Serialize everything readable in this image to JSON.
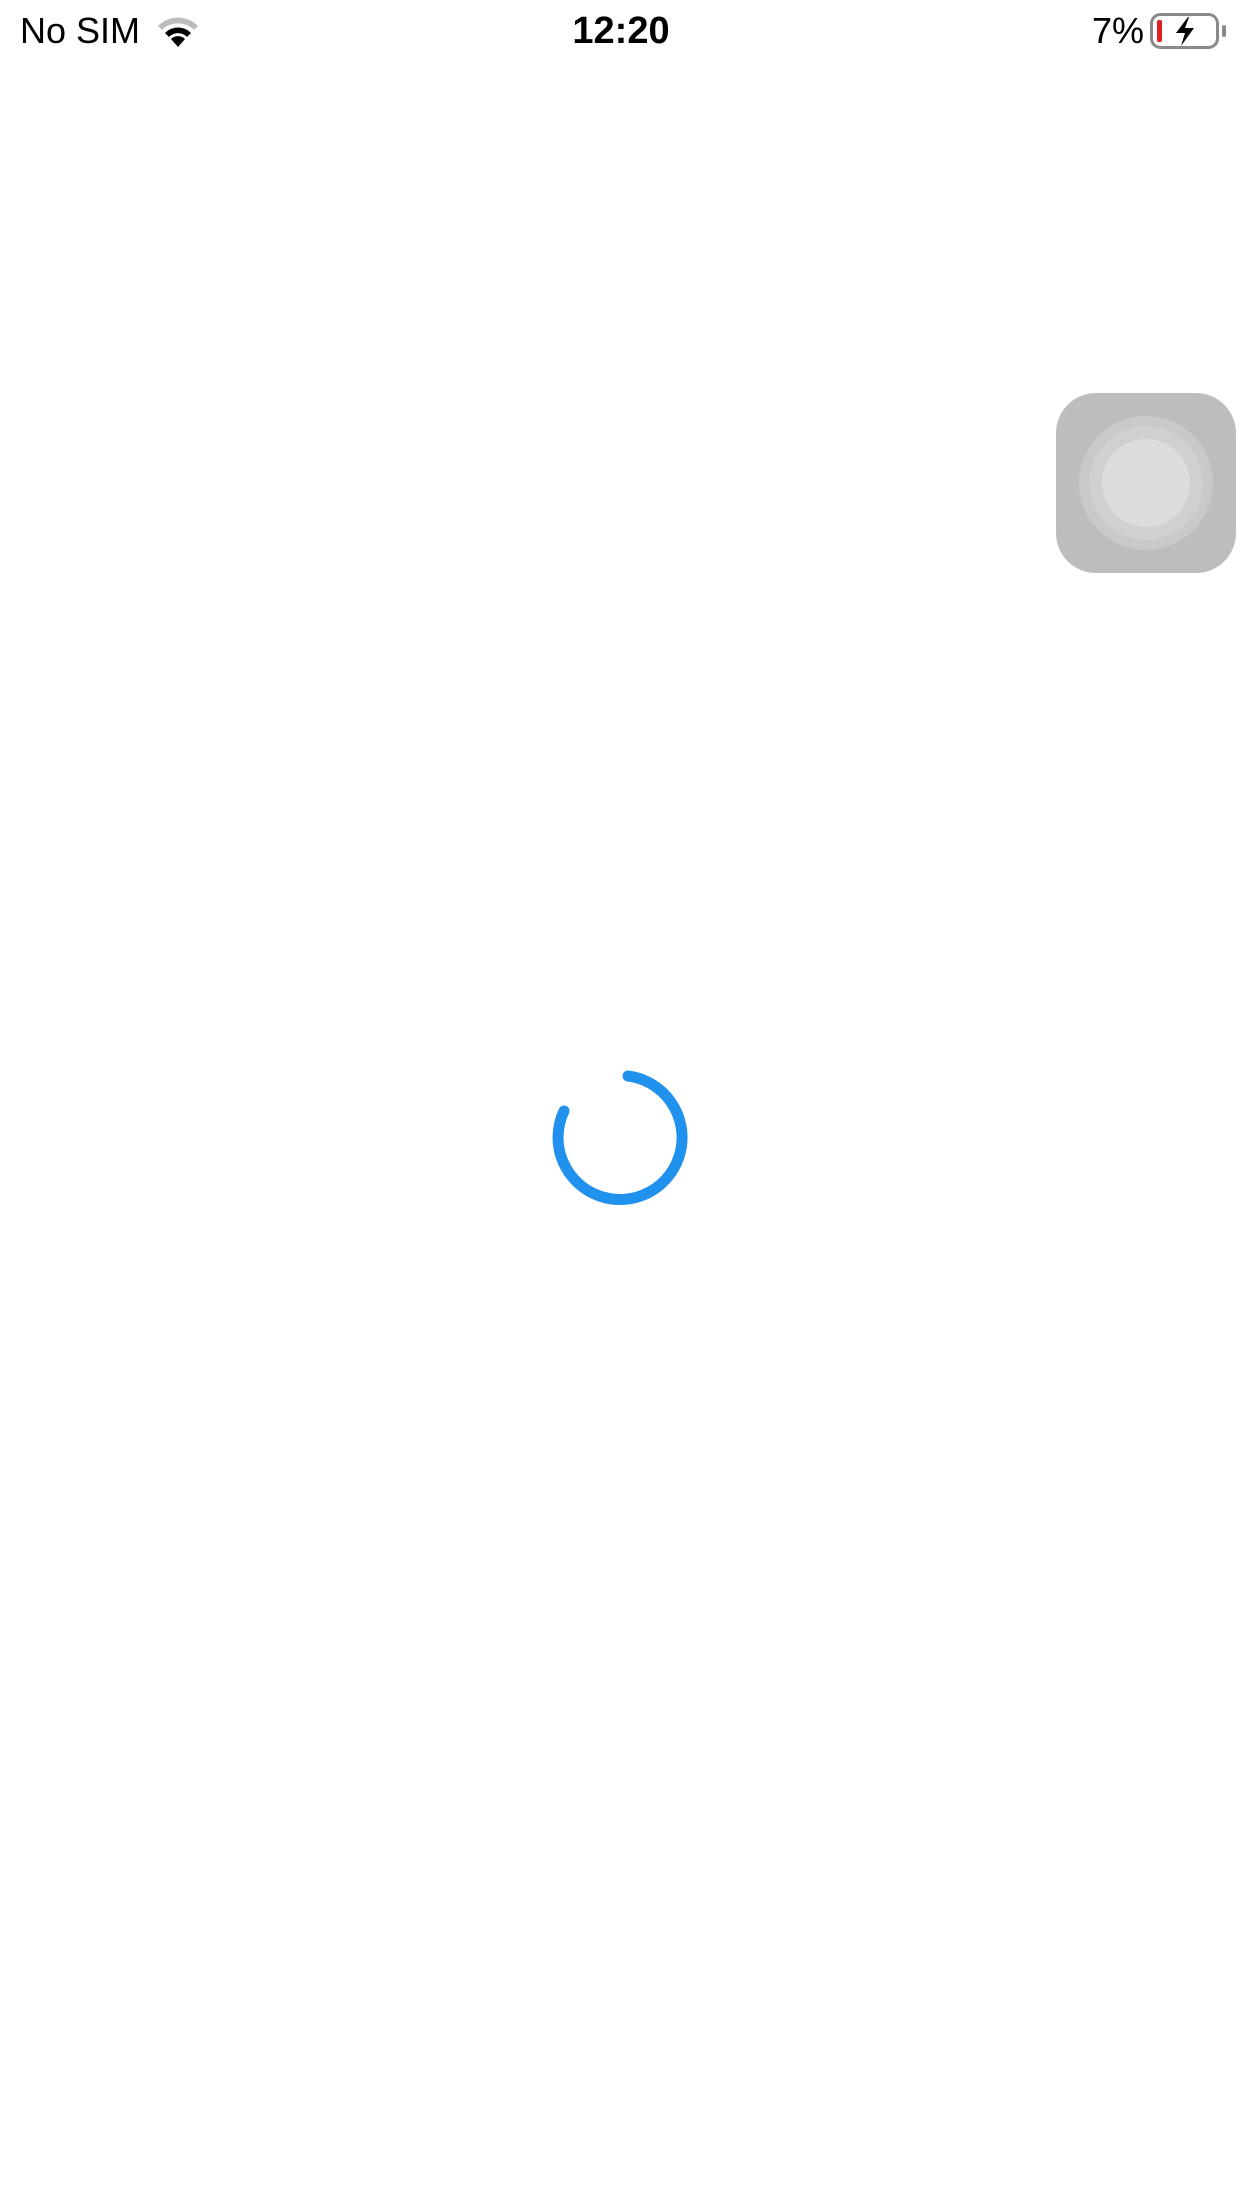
{
  "status_bar": {
    "carrier": "No SIM",
    "time": "12:20",
    "battery_percent": "7%",
    "wifi_icon": "wifi-icon",
    "battery_icon": "battery-charging-icon",
    "battery_level_fraction": 0.07,
    "battery_low_color": "#e02020"
  },
  "assistive_touch": {
    "icon": "assistive-touch-icon"
  },
  "loading": {
    "icon": "loading-spinner-icon",
    "color": "#2191ee"
  }
}
